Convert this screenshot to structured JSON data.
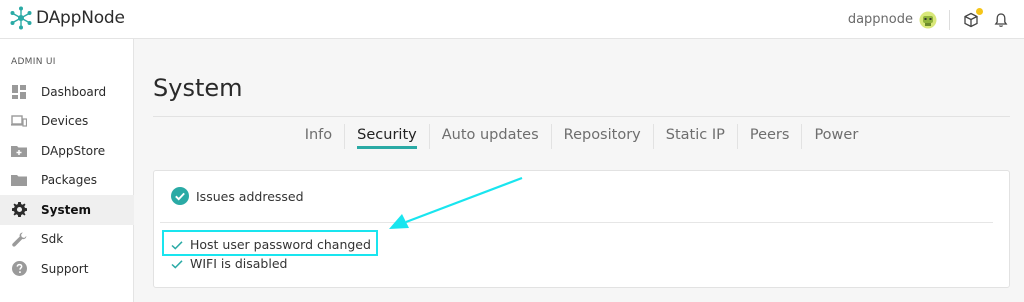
{
  "app": {
    "brand": "DAppNode",
    "brand_color": "#2aaaa5"
  },
  "topbar": {
    "username": "dappnode",
    "icons": [
      "avatar-icon",
      "package-box-icon",
      "bell-icon"
    ],
    "notification_dot_color": "#f5c518"
  },
  "sidebar": {
    "section_title": "ADMIN UI",
    "items": [
      {
        "label": "Dashboard",
        "icon": "dashboard-icon",
        "active": false
      },
      {
        "label": "Devices",
        "icon": "devices-icon",
        "active": false
      },
      {
        "label": "DAppStore",
        "icon": "dappstore-icon",
        "active": false
      },
      {
        "label": "Packages",
        "icon": "folder-icon",
        "active": false
      },
      {
        "label": "System",
        "icon": "gear-icon",
        "active": true
      },
      {
        "label": "Sdk",
        "icon": "wrench-icon",
        "active": false
      },
      {
        "label": "Support",
        "icon": "help-icon",
        "active": false
      }
    ]
  },
  "main": {
    "title": "System",
    "tabs": [
      {
        "label": "Info",
        "active": false
      },
      {
        "label": "Security",
        "active": true
      },
      {
        "label": "Auto updates",
        "active": false
      },
      {
        "label": "Repository",
        "active": false
      },
      {
        "label": "Static IP",
        "active": false
      },
      {
        "label": "Peers",
        "active": false
      },
      {
        "label": "Power",
        "active": false
      }
    ],
    "security": {
      "status": "Issues addressed",
      "checks": [
        {
          "label": "Host user password changed",
          "highlighted": true
        },
        {
          "label": "WIFI is disabled",
          "highlighted": false
        }
      ]
    }
  },
  "annotation": {
    "color": "#19e5ef"
  }
}
